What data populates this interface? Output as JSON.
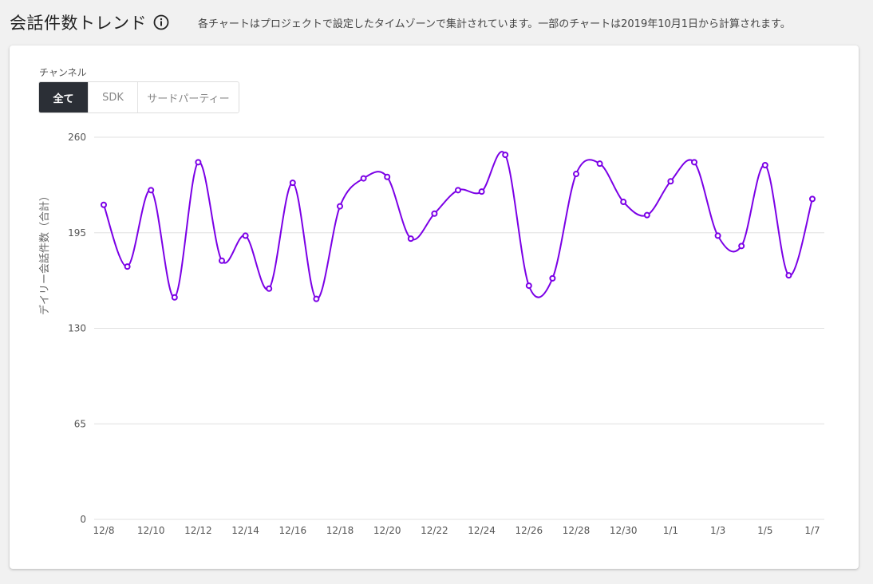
{
  "header": {
    "title": "会話件数トレンド",
    "note": "各チャートはプロジェクトで設定したタイムゾーンで集計されています。一部のチャートは2019年10月1日から計算されます。"
  },
  "filter": {
    "label": "チャンネル",
    "options": [
      "全て",
      "SDK",
      "サードパーティー"
    ],
    "selected": "全て"
  },
  "colors": {
    "series": "#7b00e6",
    "grid": "#e0e0e0",
    "active_button": "#2b2f36"
  },
  "chart_data": {
    "type": "line",
    "title": "",
    "xlabel": "",
    "ylabel": "デイリー会話件数（合計）",
    "ylim": [
      0,
      260
    ],
    "yticks": [
      0,
      65,
      130,
      195,
      260
    ],
    "xticks": [
      "12/8",
      "12/10",
      "12/12",
      "12/14",
      "12/16",
      "12/18",
      "12/20",
      "12/22",
      "12/24",
      "12/26",
      "12/28",
      "12/30",
      "1/1",
      "1/3",
      "1/5",
      "1/7"
    ],
    "x": [
      "12/8",
      "12/9",
      "12/10",
      "12/11",
      "12/12",
      "12/13",
      "12/14",
      "12/15",
      "12/16",
      "12/17",
      "12/18",
      "12/19",
      "12/20",
      "12/21",
      "12/22",
      "12/23",
      "12/24",
      "12/25",
      "12/26",
      "12/27",
      "12/28",
      "12/29",
      "12/30",
      "12/31",
      "1/1",
      "1/2",
      "1/3",
      "1/4",
      "1/5",
      "1/6",
      "1/7"
    ],
    "series": [
      {
        "values": [
          214,
          172,
          224,
          151,
          243,
          176,
          193,
          157,
          229,
          150,
          213,
          232,
          233,
          191,
          208,
          224,
          223,
          248,
          159,
          164,
          235,
          242,
          216,
          207,
          230,
          243,
          193,
          186,
          241,
          166,
          218
        ]
      }
    ],
    "grid": true,
    "legend": "none"
  }
}
